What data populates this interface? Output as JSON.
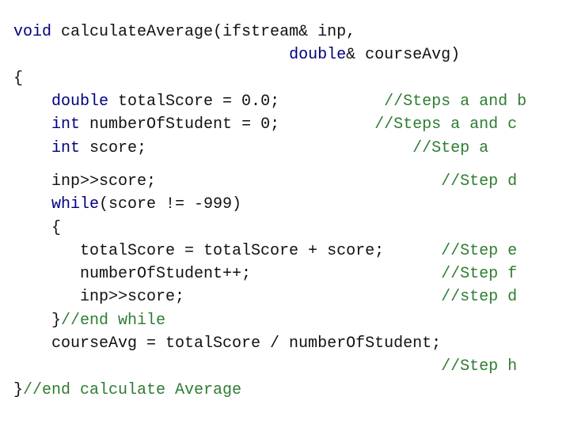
{
  "colors": {
    "keyword": "#000080",
    "comment": "#2e7d32",
    "text": "#111111",
    "background": "#ffffff"
  },
  "lines": [
    {
      "row": 0,
      "indent": 0,
      "tokens": [
        {
          "t": "void",
          "k": "kw"
        },
        {
          "t": " calculateAverage(ifstream& inp,",
          "k": "tx"
        }
      ]
    },
    {
      "row": 1,
      "indent": 0,
      "tokens": [
        {
          "t": "                             ",
          "k": "tx"
        },
        {
          "t": "double",
          "k": "kw"
        },
        {
          "t": "& courseAvg)",
          "k": "tx"
        }
      ]
    },
    {
      "row": 2,
      "indent": 0,
      "tokens": [
        {
          "t": "{",
          "k": "tx"
        }
      ]
    },
    {
      "row": 3,
      "indent": 0,
      "tokens": [
        {
          "t": "    ",
          "k": "tx"
        },
        {
          "t": "double",
          "k": "kw"
        },
        {
          "t": " totalScore = 0.0;",
          "k": "tx"
        },
        {
          "t": "           //Steps a and b",
          "k": "cm"
        }
      ]
    },
    {
      "row": 4,
      "indent": 0,
      "tokens": [
        {
          "t": "    ",
          "k": "tx"
        },
        {
          "t": "int",
          "k": "kw"
        },
        {
          "t": " numberOfStudent = 0;",
          "k": "tx"
        },
        {
          "t": "          //Steps a and c",
          "k": "cm"
        }
      ]
    },
    {
      "row": 5,
      "indent": 0,
      "tokens": [
        {
          "t": "    ",
          "k": "tx"
        },
        {
          "t": "int",
          "k": "kw"
        },
        {
          "t": " score;",
          "k": "tx"
        },
        {
          "t": "                            //Step a",
          "k": "cm"
        }
      ]
    },
    {
      "row": 6.45,
      "indent": 0,
      "tokens": [
        {
          "t": "    inp>>score;",
          "k": "tx"
        },
        {
          "t": "                              //Step d",
          "k": "cm"
        }
      ]
    },
    {
      "row": 7.45,
      "indent": 0,
      "tokens": [
        {
          "t": "    ",
          "k": "tx"
        },
        {
          "t": "while",
          "k": "kw"
        },
        {
          "t": "(score != -999)",
          "k": "tx"
        }
      ]
    },
    {
      "row": 8.45,
      "indent": 0,
      "tokens": [
        {
          "t": "    {",
          "k": "tx"
        }
      ]
    },
    {
      "row": 9.45,
      "indent": 0,
      "tokens": [
        {
          "t": "       totalScore = totalScore + score;",
          "k": "tx"
        },
        {
          "t": "      //Step e",
          "k": "cm"
        }
      ]
    },
    {
      "row": 10.45,
      "indent": 0,
      "tokens": [
        {
          "t": "       numberOfStudent++;",
          "k": "tx"
        },
        {
          "t": "                    //Step f",
          "k": "cm"
        }
      ]
    },
    {
      "row": 11.45,
      "indent": 0,
      "tokens": [
        {
          "t": "       inp>>score;",
          "k": "tx"
        },
        {
          "t": "                           //step d",
          "k": "cm"
        }
      ]
    },
    {
      "row": 12.45,
      "indent": 0,
      "tokens": [
        {
          "t": "    }",
          "k": "tx"
        },
        {
          "t": "//end while",
          "k": "cm"
        }
      ]
    },
    {
      "row": 13.45,
      "indent": 0,
      "tokens": [
        {
          "t": "    courseAvg = totalScore / numberOfStudent;",
          "k": "tx"
        }
      ]
    },
    {
      "row": 14.45,
      "indent": 0,
      "tokens": [
        {
          "t": "                                             ",
          "k": "tx"
        },
        {
          "t": "//Step h",
          "k": "cm"
        }
      ]
    },
    {
      "row": 15.45,
      "indent": 0,
      "tokens": [
        {
          "t": "}",
          "k": "tx"
        },
        {
          "t": "//end calculate Average",
          "k": "cm"
        }
      ]
    }
  ]
}
